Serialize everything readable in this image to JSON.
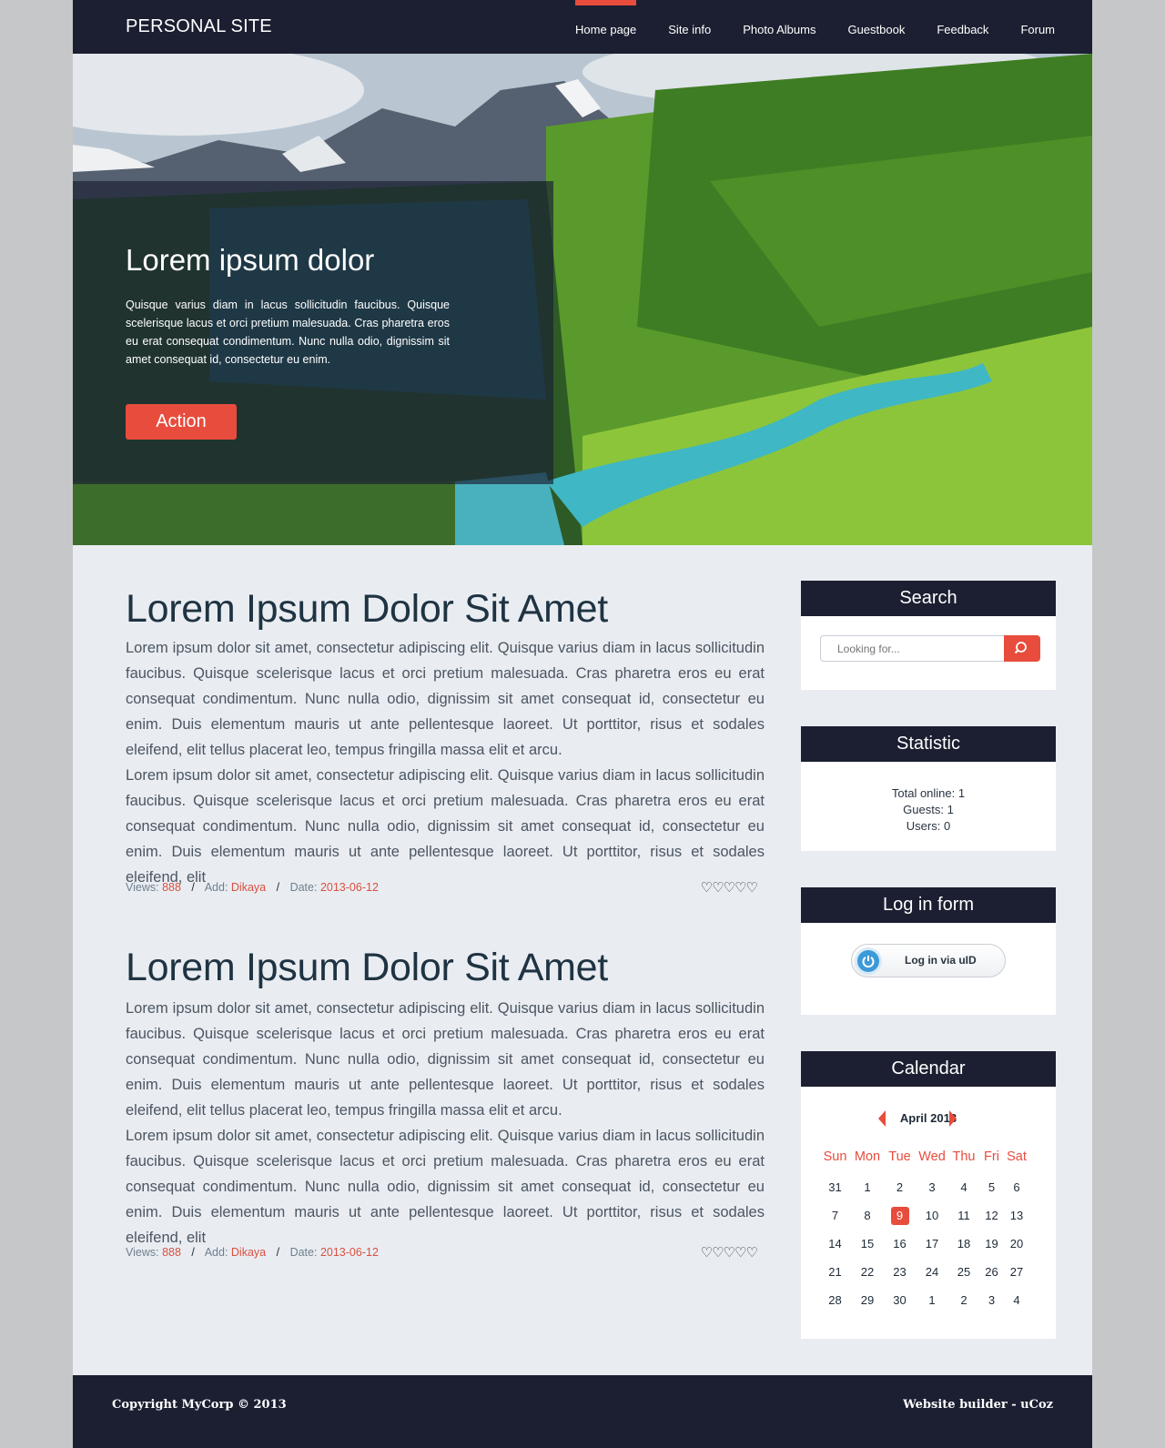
{
  "header": {
    "logo": "PERSONAL SITE",
    "nav": [
      "Home page",
      "Site info",
      "Photo Albums",
      "Guestbook",
      "Feedback",
      "Forum"
    ],
    "active_nav": "Home page"
  },
  "hero": {
    "title": "Lorem ipsum dolor",
    "text": "Quisque varius diam in lacus sollicitudin faucibus. Quisque scelerisque lacus et orci pretium malesuada. Cras pharetra eros eu erat consequat condimentum. Nunc nulla odio, dignissim sit amet consequat id, consectetur eu enim.",
    "button": "Action"
  },
  "posts": [
    {
      "title": "Lorem Ipsum Dolor Sit Amet",
      "paragraphs": [
        "Lorem ipsum dolor sit amet, consectetur adipiscing elit. Quisque varius diam in lacus sollicitudin faucibus. Quisque scelerisque lacus et orci pretium malesuada. Cras pharetra eros eu erat consequat condimentum. Nunc nulla odio, dignissim sit amet consequat id, consectetur eu enim. Duis elementum mauris ut ante pellentesque laoreet. Ut porttitor, risus et sodales eleifend, elit tellus placerat leo, tempus fringilla massa elit et arcu.",
        "Lorem ipsum dolor sit amet, consectetur adipiscing elit. Quisque varius diam in lacus sollicitudin faucibus. Quisque scelerisque lacus et orci pretium malesuada. Cras pharetra eros eu erat consequat condimentum. Nunc nulla odio, dignissim sit amet consequat id, consectetur eu enim. Duis elementum mauris ut ante pellentesque laoreet. Ut porttitor, risus et sodales eleifend, elit"
      ],
      "meta": {
        "views_label": "Views:",
        "views": "888",
        "add_label": "Add:",
        "author": "Dikaya",
        "date_label": "Date:",
        "date": "2013-06-12"
      },
      "rating": "♡♡♡♡♡"
    },
    {
      "title": "Lorem Ipsum Dolor Sit Amet",
      "paragraphs": [
        "Lorem ipsum dolor sit amet, consectetur adipiscing elit. Quisque varius diam in lacus sollicitudin faucibus. Quisque scelerisque lacus et orci pretium malesuada. Cras pharetra eros eu erat consequat condimentum. Nunc nulla odio, dignissim sit amet consequat id, consectetur eu enim. Duis elementum mauris ut ante pellentesque laoreet. Ut porttitor, risus et sodales eleifend, elit tellus placerat leo, tempus fringilla massa elit et arcu.",
        "Lorem ipsum dolor sit amet, consectetur adipiscing elit. Quisque varius diam in lacus sollicitudin faucibus. Quisque scelerisque lacus et orci pretium malesuada. Cras pharetra eros eu erat consequat condimentum. Nunc nulla odio, dignissim sit amet consequat id, consectetur eu enim. Duis elementum mauris ut ante pellentesque laoreet. Ut porttitor, risus et sodales eleifend, elit"
      ],
      "meta": {
        "views_label": "Views:",
        "views": "888",
        "add_label": "Add:",
        "author": "Dikaya",
        "date_label": "Date:",
        "date": "2013-06-12"
      },
      "rating": "♡♡♡♡♡"
    }
  ],
  "sidebar": {
    "search": {
      "title": "Search",
      "placeholder": "Looking for...",
      "icon": "search-icon"
    },
    "statistic": {
      "title": "Statistic",
      "lines": [
        "Total online: 1",
        "Guests: 1",
        "Users: 0"
      ]
    },
    "login": {
      "title": "Log in form",
      "button": "Log in via uID",
      "icon": "uid-icon"
    },
    "calendar": {
      "title": "Calendar",
      "month": "April 2013",
      "weekdays": [
        "Sun",
        "Mon",
        "Tue",
        "Wed",
        "Thu",
        "Fri",
        "Sat"
      ],
      "weeks": [
        [
          "31",
          "1",
          "2",
          "3",
          "4",
          "5",
          "6"
        ],
        [
          "7",
          "8",
          "9",
          "10",
          "11",
          "12",
          "13"
        ],
        [
          "14",
          "15",
          "16",
          "17",
          "18",
          "19",
          "20"
        ],
        [
          "21",
          "22",
          "23",
          "24",
          "25",
          "26",
          "27"
        ],
        [
          "28",
          "29",
          "30",
          "1",
          "2",
          "3",
          "4"
        ]
      ],
      "today": "9"
    }
  },
  "footer": {
    "copyright": "Copyright MyCorp © 2013",
    "builder": "Website builder - uCoz"
  },
  "colors": {
    "accent": "#e84c3d",
    "dark": "#1b1f31",
    "background": "#e9edf2"
  }
}
